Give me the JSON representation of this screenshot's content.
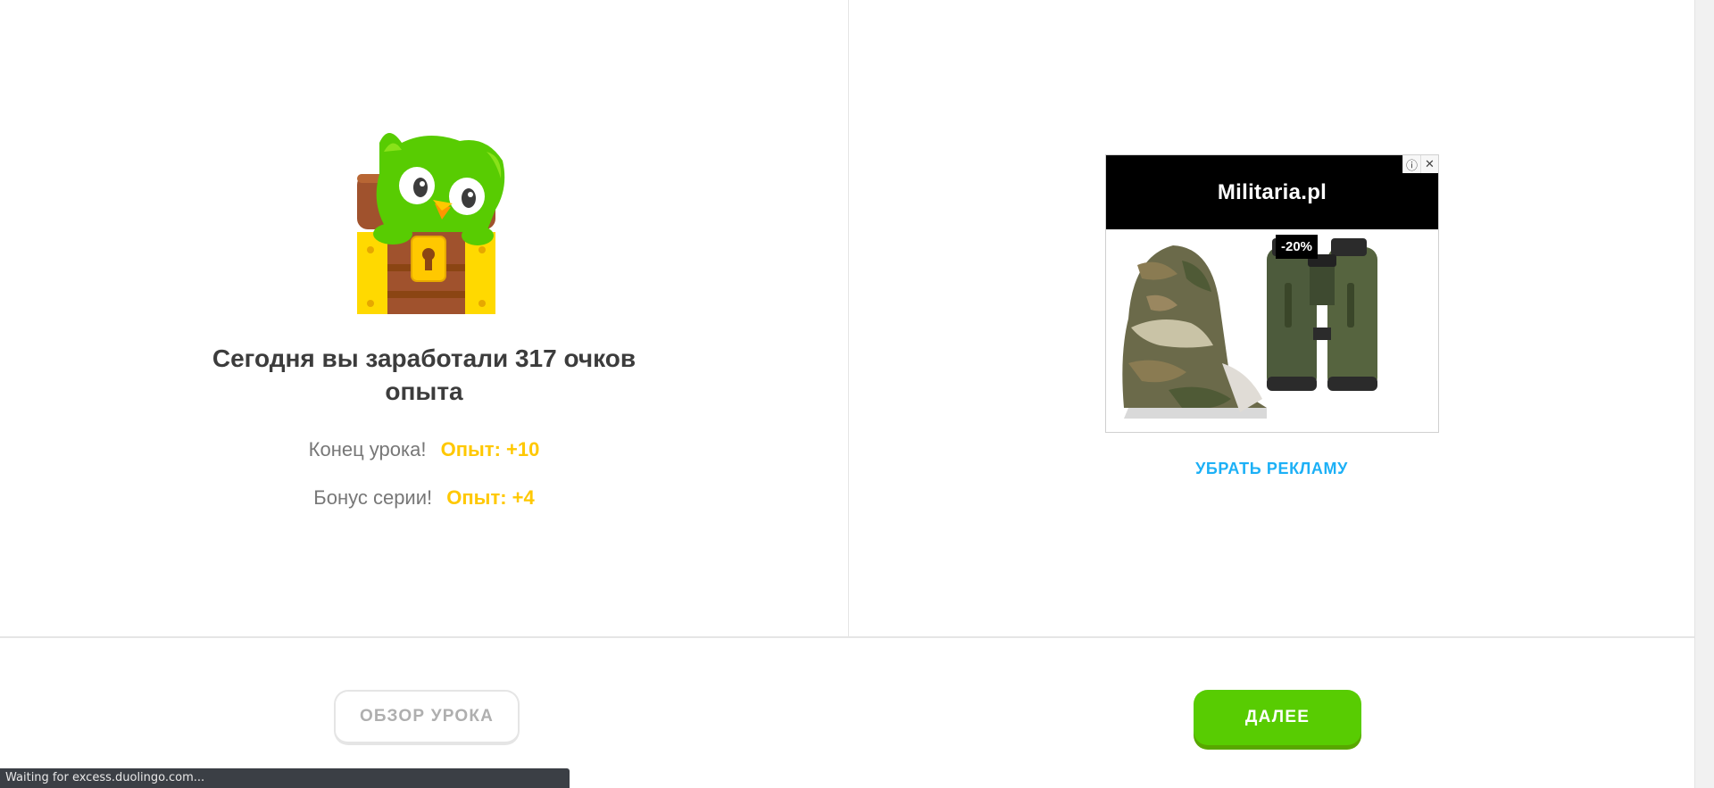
{
  "lesson_result": {
    "title": "Сегодня вы заработали 317 очков опыта",
    "rows": [
      {
        "label": "Конец урока!",
        "value": "Опыт: +10"
      },
      {
        "label": "Бонус серии!",
        "value": "Опыт: +4"
      }
    ],
    "mascot_icon": "owl-in-treasure-chest"
  },
  "ad": {
    "brand": "Militaria.pl",
    "discount": "-20%",
    "info_icon": "info-icon",
    "close_icon": "close-icon",
    "product_left": "camouflage-balaclava",
    "product_right": "binoculars",
    "remove_ads_label": "УБРАТЬ РЕКЛАМУ"
  },
  "footer": {
    "review_label": "ОБЗОР УРОКА",
    "next_label": "ДАЛЕЕ"
  },
  "status_bar": {
    "text": "Waiting for excess.duolingo.com..."
  },
  "colors": {
    "accent_green": "#58cc02",
    "xp_yellow": "#ffc800",
    "link_blue": "#1cb0f6"
  }
}
